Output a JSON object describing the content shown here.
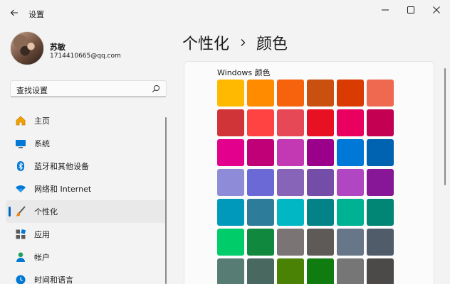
{
  "titlebar": {
    "app_title": "设置"
  },
  "profile": {
    "name": "苏敏",
    "email": "1714410665@qq.com"
  },
  "search": {
    "text": "查找设置",
    "icon": "search-icon"
  },
  "nav": {
    "items": [
      {
        "label": "主页",
        "icon": "home-icon"
      },
      {
        "label": "系统",
        "icon": "system-icon"
      },
      {
        "label": "蓝牙和其他设备",
        "icon": "bluetooth-icon"
      },
      {
        "label": "网络和 Internet",
        "icon": "wifi-icon"
      },
      {
        "label": "个性化",
        "icon": "brush-icon",
        "active": true
      },
      {
        "label": "应用",
        "icon": "apps-icon"
      },
      {
        "label": "帐户",
        "icon": "account-icon"
      },
      {
        "label": "时间和语言",
        "icon": "time-language-icon"
      }
    ]
  },
  "breadcrumb": {
    "parent": "个性化",
    "current": "颜色"
  },
  "colors": {
    "section_title": "Windows 颜色",
    "swatches": [
      "#ffb900",
      "#ff8c00",
      "#f7630c",
      "#ca5010",
      "#da3b01",
      "#ef6950",
      "#d13438",
      "#ff4343",
      "#e74856",
      "#e81123",
      "#ea005e",
      "#c30052",
      "#e3008c",
      "#bf0077",
      "#c239b3",
      "#9a0089",
      "#0078d7",
      "#0063b1",
      "#8e8cd8",
      "#6b69d6",
      "#8764b8",
      "#744da9",
      "#b146c2",
      "#881798",
      "#0099bc",
      "#2d7d9a",
      "#00b7c3",
      "#038387",
      "#00b294",
      "#018574",
      "#00cc6a",
      "#10893e",
      "#7a7574",
      "#5d5a58",
      "#68768a",
      "#515c6b",
      "#567c73",
      "#486860",
      "#498205",
      "#107c10",
      "#767676",
      "#4c4a48"
    ]
  },
  "accent": "#0067c0"
}
